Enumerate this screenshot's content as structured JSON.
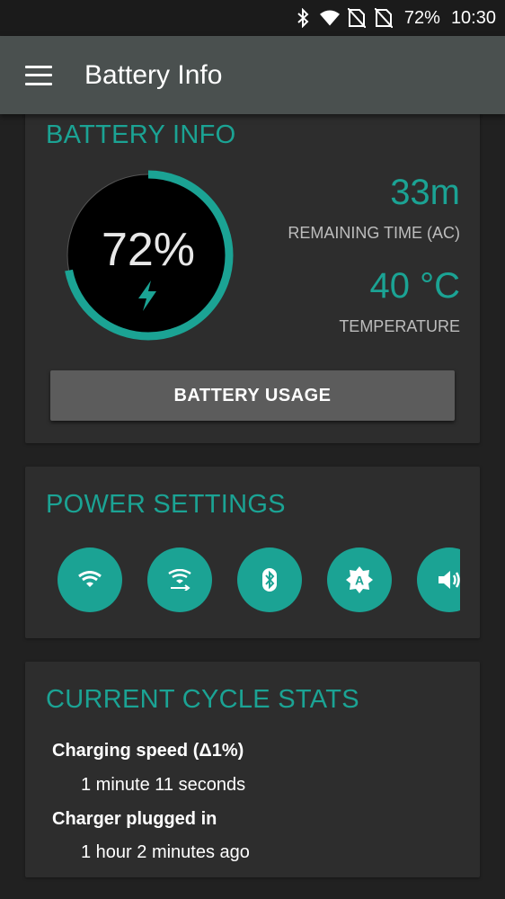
{
  "status_bar": {
    "battery": "72%",
    "time": "10:30",
    "icons": [
      "bluetooth-icon",
      "wifi-icon",
      "no-sim-icon",
      "no-sim-icon"
    ]
  },
  "toolbar": {
    "title": "Battery Info",
    "menu_icon": "hamburger-menu-icon"
  },
  "battery_card": {
    "title": "BATTERY INFO",
    "level_text": "72%",
    "level": 0.72,
    "charging_icon": "lightning-bolt-icon",
    "remaining_value": "33m",
    "remaining_label": "REMAINING TIME (AC)",
    "temperature_value": "40 °C",
    "temperature_label": "TEMPERATURE",
    "usage_button": "BATTERY USAGE"
  },
  "power_card": {
    "title": "POWER SETTINGS",
    "toggles": [
      "wifi-icon",
      "wifi-hotspot-icon",
      "bluetooth-icon",
      "auto-brightness-icon",
      "volume-icon"
    ]
  },
  "cycle_card": {
    "title": "CURRENT CYCLE STATS",
    "items": [
      {
        "heading": "Charging speed (Δ1%)",
        "value": "1 minute 11 seconds"
      },
      {
        "heading": "Charger plugged in",
        "value": "1 hour 2 minutes ago"
      }
    ]
  },
  "colors": {
    "accent": "#1ba394",
    "toolbar": "#4a504f",
    "card": "#2d2d2d",
    "background": "#212121"
  }
}
